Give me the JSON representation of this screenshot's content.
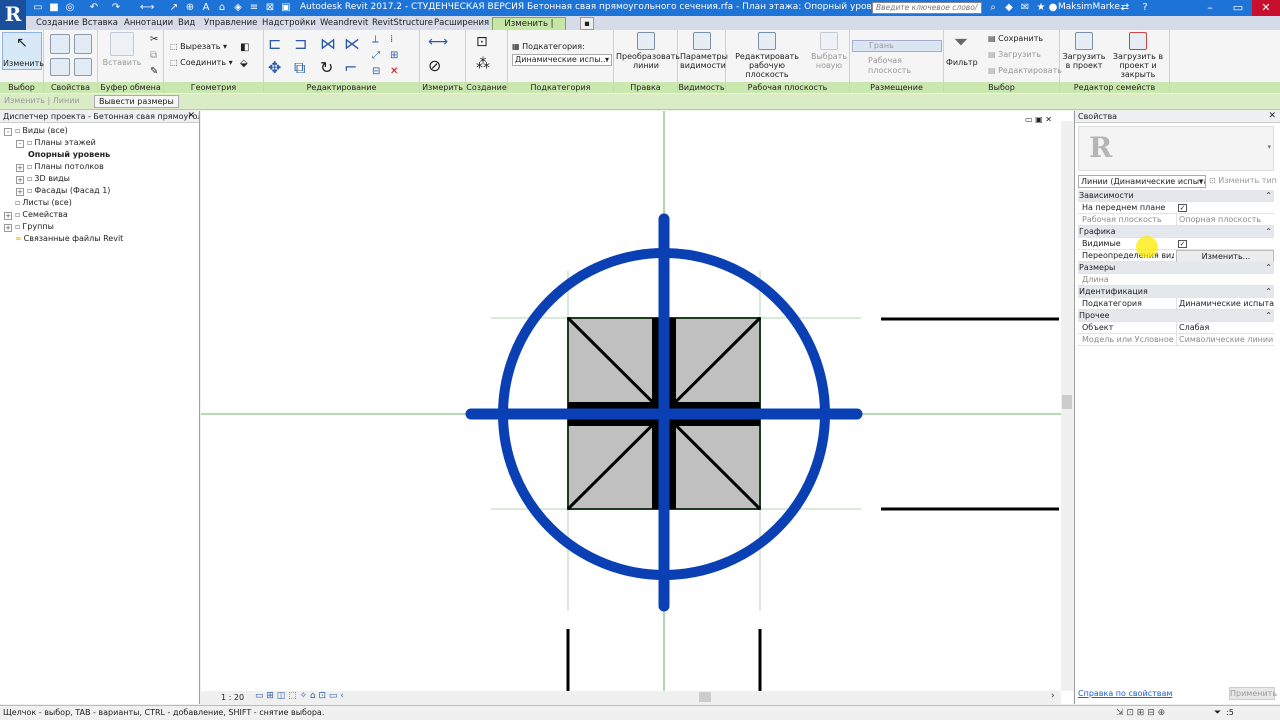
{
  "title_bar": {
    "title": "Autodesk Revit 2017.2 - СТУДЕНЧЕСКАЯ ВЕРСИЯ     Бетонная свая прямоугольного сечения.rfa - План этажа: Опорный уровень",
    "search_placeholder": "Введите ключевое слово/фразу",
    "user": "MaksimMarke...",
    "logo": "R"
  },
  "tabs": [
    "Создание",
    "Вставка",
    "Аннотации",
    "Вид",
    "Управление",
    "Надстройки",
    "Weandrevit",
    "RevitStructure",
    "Расширения",
    "Изменить | Линии"
  ],
  "ribbon": {
    "modify_label": "Изменить",
    "paste_label": "Вставить",
    "cut_label": "Вырезать",
    "join_label": "Соединить",
    "subcategory_label": "Подкатегория:",
    "subcategory_value": "Динамические испы...",
    "convert_label": "Преобразовать линии",
    "visibility_params_label": "Параметры видимости",
    "edit_workplane_label": "Редактировать рабочую плоскость",
    "select_new_label": "Выбрать новую",
    "face_label": "Грань",
    "workplane_label": "Рабочая плоскость",
    "filter_label": "Фильтр",
    "save_label": "Сохранить",
    "load_label": "Загрузить",
    "edit_label": "Редактировать",
    "load_to_project_label": "Загрузить в проект",
    "load_to_project_close_label": "Загрузить в проект и закрыть",
    "panels": {
      "select": "Выбор",
      "properties": "Свойства",
      "clipboard": "Буфер обмена",
      "geometry": "Геометрия",
      "modify": "Редактирование",
      "measure": "Измерить",
      "create": "Создание",
      "subcategory": "Подкатегория",
      "edit": "Правка",
      "visibility": "Видимость",
      "workplane": "Рабочая плоскость",
      "placement": "Размещение",
      "selection": "Выбор",
      "family_editor": "Редактор семейств"
    }
  },
  "options_bar": {
    "edit_lines": "Изменить | Линии",
    "show_dims": "Вывести размеры"
  },
  "project_browser": {
    "title": "Диспетчер проекта - Бетонная свая прямоуголь...",
    "items": [
      {
        "label": "Виды (все)",
        "level": 0,
        "expand": "-"
      },
      {
        "label": "Планы этажей",
        "level": 1,
        "expand": "-"
      },
      {
        "label": "Опорный уровень",
        "level": 2,
        "expand": ""
      },
      {
        "label": "Планы потолков",
        "level": 1,
        "expand": "+"
      },
      {
        "label": "3D виды",
        "level": 1,
        "expand": "+"
      },
      {
        "label": "Фасады (Фасад 1)",
        "level": 1,
        "expand": "+"
      },
      {
        "label": "Листы (все)",
        "level": 0,
        "expand": ""
      },
      {
        "label": "Семейства",
        "level": 0,
        "expand": "+"
      },
      {
        "label": "Группы",
        "level": 0,
        "expand": "+"
      },
      {
        "label": "Связанные файлы Revit",
        "level": 0,
        "expand": ""
      }
    ]
  },
  "properties": {
    "title": "Свойства",
    "type_selector": "Линии (Динамические испыта",
    "edit_type": "Изменить тип",
    "rows": [
      {
        "kind": "cat",
        "name": "Зависимости"
      },
      {
        "kind": "chk",
        "name": "На переднем плане",
        "value": "✓"
      },
      {
        "kind": "val",
        "name": "Рабочая плоскость",
        "value": "Опорная плоскость",
        "dim": true
      },
      {
        "kind": "cat",
        "name": "Графика"
      },
      {
        "kind": "chk",
        "name": "Видимые",
        "value": "✓"
      },
      {
        "kind": "btn",
        "name": "Переопределения вид...",
        "value": "Изменить..."
      },
      {
        "kind": "cat",
        "name": "Размеры"
      },
      {
        "kind": "val",
        "name": "Длина",
        "value": "",
        "dim": true
      },
      {
        "kind": "cat",
        "name": "Идентификация"
      },
      {
        "kind": "val",
        "name": "Подкатегория",
        "value": "Динамические испытан..."
      },
      {
        "kind": "cat",
        "name": "Прочее"
      },
      {
        "kind": "val",
        "name": "Объект",
        "value": "Слабая"
      },
      {
        "kind": "val",
        "name": "Модель или Условное",
        "value": "Символические линии",
        "dim": true
      }
    ],
    "help_link": "Справка по свойствам",
    "apply_label": "Применить"
  },
  "view": {
    "scale": "1 : 20"
  },
  "status": {
    "text": "Щелчок - выбор, TAB - варианты, CTRL - добавление, SHIFT - снятие выбора.",
    "filter_count": ":5"
  },
  "colors": {
    "title_blue": "#1e73d6",
    "ribbon_green": "#c9e7ae",
    "symbol_blue": "#0a40b4",
    "ref_green": "#3c9a3c"
  }
}
